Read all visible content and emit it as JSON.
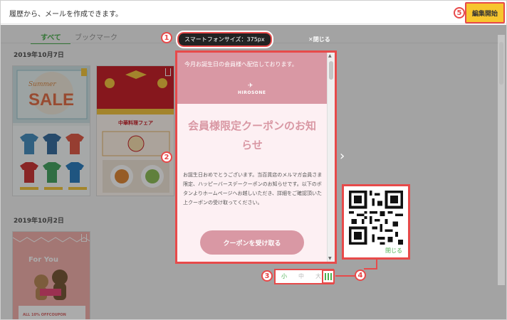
{
  "header": {
    "message": "履歴から、メールを作成できます。",
    "edit_button": "編集開始"
  },
  "tabs": {
    "all": "すべて",
    "bookmark": "ブックマーク"
  },
  "dates": [
    "2019年10月7日",
    "2019年10月2日"
  ],
  "templates": {
    "sale_card": {
      "word": "SALE",
      "subtitle": "Summer"
    },
    "chinese_card": {
      "banner": "中華料理フェア"
    },
    "bear_card": {
      "headline": "For You",
      "coupon": "ALL 10% OFFCOUPON"
    }
  },
  "preview": {
    "size_chip": "スマートフォンサイズ：375px",
    "close_label": "✕閉じる",
    "preheader": "今月お誕生日の会員様へ配信しております。",
    "logo_text": "HIROSONE",
    "title": "会員様限定クーポンのお知らせ",
    "body": "お誕生日おめでとうございます。当百貨店のメルマガ会員さま限定、ハッピーバースデークーポンのお知らせです。以下のボタンよりホームページへお越しいただき、詳細をご確認頂いた上クーポンの受け取ってください。",
    "button": "クーポンを受け取る"
  },
  "size_controls": {
    "small": "小",
    "medium": "中",
    "large": "大"
  },
  "qr_popup": {
    "close": "閉じる"
  },
  "callouts": [
    "1",
    "2",
    "3",
    "4",
    "5"
  ],
  "colors": {
    "accent_red": "#e74a4a",
    "green": "#4caf50",
    "yellow": "#f7c62e",
    "pink": "#d998a4"
  }
}
